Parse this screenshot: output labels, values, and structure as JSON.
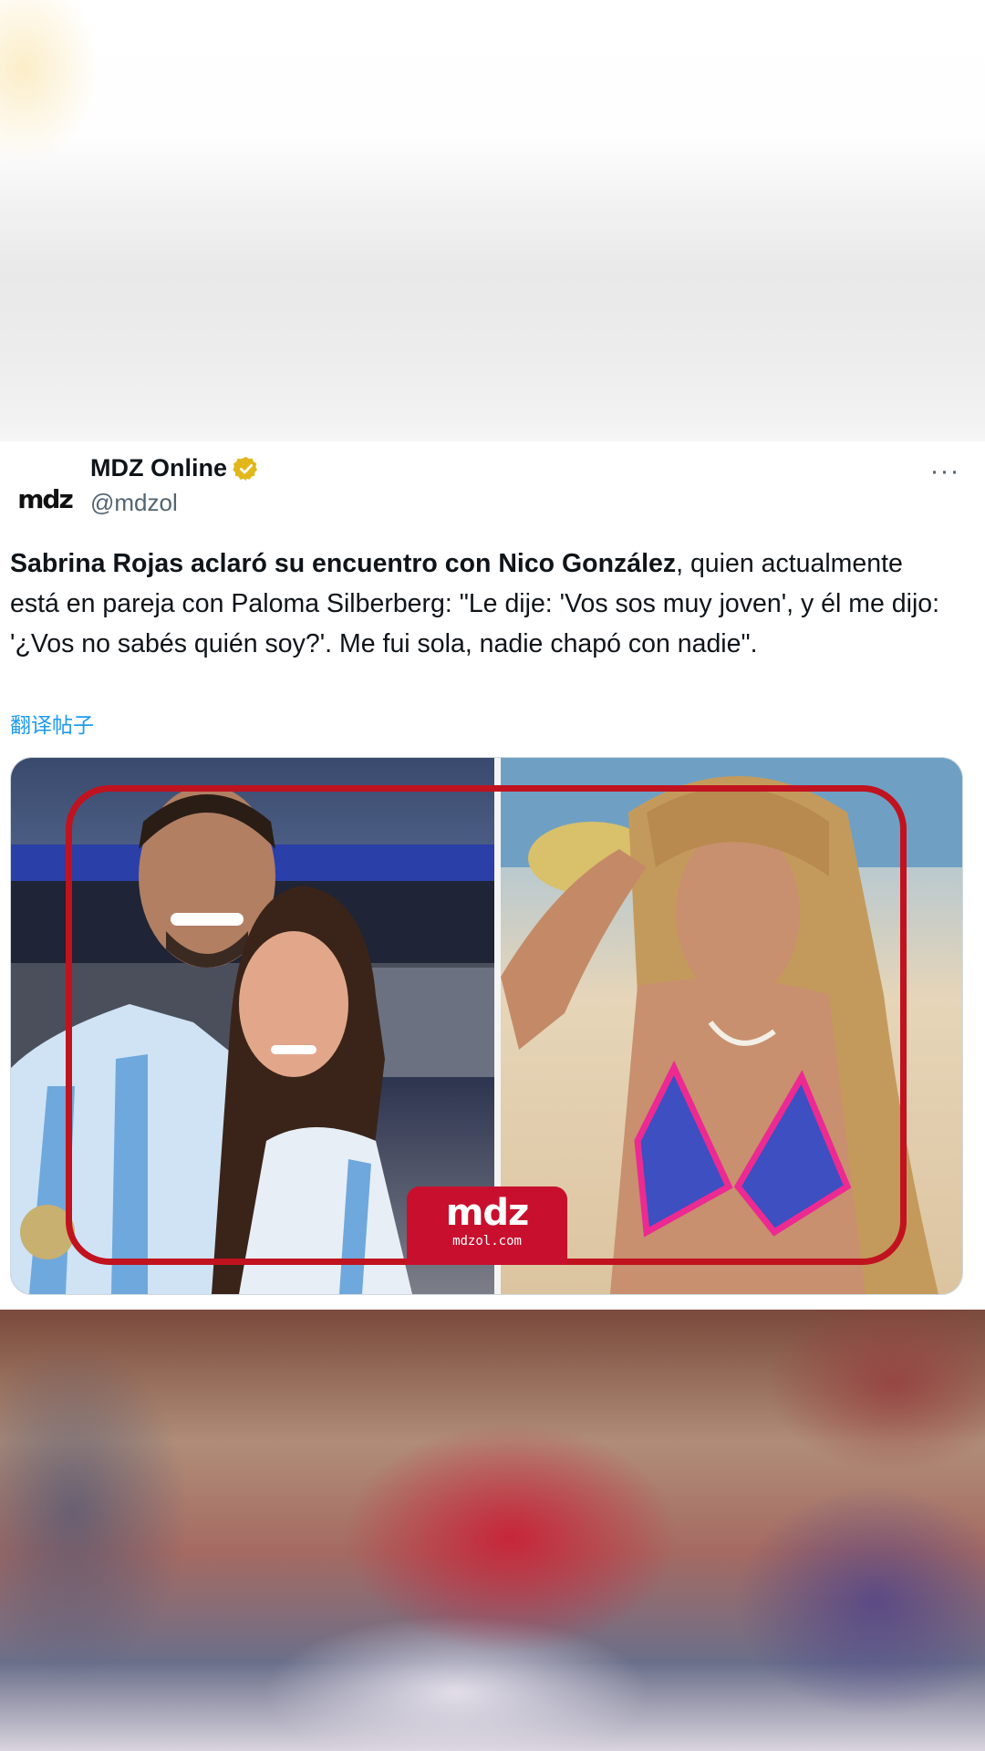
{
  "tweet": {
    "display_name": "MDZ Online",
    "handle": "@mdzol",
    "avatar_text": "mdz",
    "more_label": "···",
    "text_bold": "Sabrina Rojas aclaró su encuentro con Nico González",
    "text_rest": ", quien actualmente está en pareja con Paloma Silberberg: \"Le dije: 'Vos sos muy joven', y él me dijo: '¿Vos no sabés quién soy?'. Me fui sola, nadie chapó con nadie\".",
    "translate_label": "翻译帖子"
  },
  "media": {
    "logo_text": "mdz",
    "logo_url": "mdzol.com"
  },
  "colors": {
    "link": "#1d9bf0",
    "verified": "#e2b719",
    "brand_red": "#c8102e"
  },
  "icons": {
    "verified": "verified-badge-icon",
    "more": "more-options-icon"
  }
}
